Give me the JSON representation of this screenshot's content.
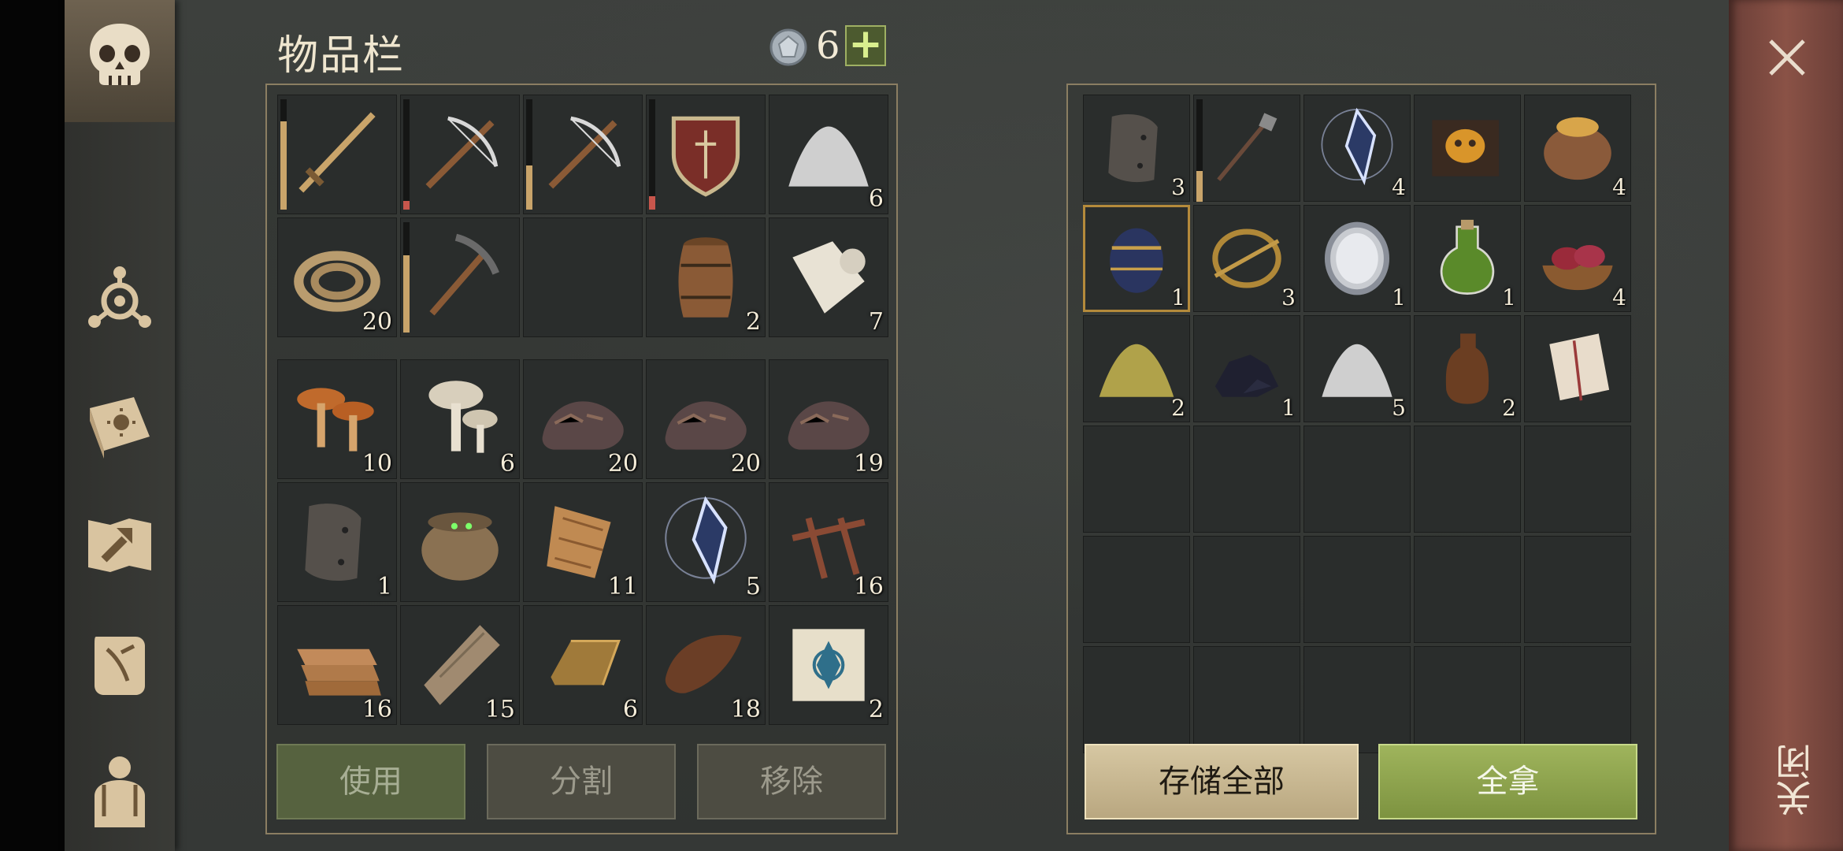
{
  "header": {
    "title": "物品栏",
    "currency_count": "6",
    "add_label": "+"
  },
  "sidebar": {
    "items": [
      {
        "icon": "skull-icon"
      },
      {
        "icon": "skills-tree-icon"
      },
      {
        "icon": "sun-journal-icon"
      },
      {
        "icon": "map-arrow-icon"
      },
      {
        "icon": "quest-scroll-icon"
      },
      {
        "icon": "character-equipment-icon"
      }
    ]
  },
  "equipment_grid": [
    {
      "item": "sword",
      "count": "",
      "durability": 0.8,
      "dur_color": "#c9a46a"
    },
    {
      "item": "crossbow",
      "count": "",
      "durability": 0.08,
      "dur_color": "#c8564c"
    },
    {
      "item": "crossbow",
      "count": "",
      "durability": 0.4,
      "dur_color": "#c9a46a"
    },
    {
      "item": "shield",
      "count": "",
      "durability": 0.12,
      "dur_color": "#c8564c"
    },
    {
      "item": "salt-pile",
      "count": "6"
    },
    {
      "item": "rope",
      "count": "20"
    },
    {
      "item": "pickaxe",
      "count": "",
      "durability": 0.7,
      "dur_color": "#c9a46a"
    },
    {
      "item": "empty",
      "count": ""
    },
    {
      "item": "barrel",
      "count": "2"
    },
    {
      "item": "cloth-roll",
      "count": "7"
    }
  ],
  "backpack_grid": [
    {
      "item": "mushrooms-orange",
      "count": "10"
    },
    {
      "item": "mushrooms-white",
      "count": "6"
    },
    {
      "item": "iron-ore",
      "count": "20"
    },
    {
      "item": "iron-ore",
      "count": "20"
    },
    {
      "item": "iron-ore",
      "count": "19"
    },
    {
      "item": "leather-pauldron",
      "count": "1"
    },
    {
      "item": "basket-with-eyes",
      "count": ""
    },
    {
      "item": "fiber-bundle",
      "count": "11"
    },
    {
      "item": "crystal",
      "count": "5"
    },
    {
      "item": "nails",
      "count": "16"
    },
    {
      "item": "leather-stack",
      "count": "16"
    },
    {
      "item": "plank",
      "count": "15"
    },
    {
      "item": "bronze-ingot",
      "count": "6"
    },
    {
      "item": "hide",
      "count": "18"
    },
    {
      "item": "pattern-scroll",
      "count": "2"
    }
  ],
  "storage_grid": [
    {
      "item": "leather-pauldron",
      "count": "3"
    },
    {
      "item": "mace",
      "count": "",
      "durability": 0.35,
      "dur_color": "#c9a46a"
    },
    {
      "item": "crystal",
      "count": "4"
    },
    {
      "item": "mask-book",
      "count": ""
    },
    {
      "item": "grain-sack",
      "count": "4"
    },
    {
      "item": "decorated-egg",
      "count": "1",
      "selected": true
    },
    {
      "item": "bronze-brooch",
      "count": "3"
    },
    {
      "item": "silver-mirror",
      "count": "1"
    },
    {
      "item": "green-potion",
      "count": "1"
    },
    {
      "item": "meat-bowl",
      "count": "4"
    },
    {
      "item": "sulfur-pile",
      "count": "2"
    },
    {
      "item": "coal",
      "count": "1"
    },
    {
      "item": "salt-pile",
      "count": "5"
    },
    {
      "item": "clay-bottle",
      "count": "2"
    },
    {
      "item": "paper-bundle",
      "count": ""
    },
    {
      "item": "empty"
    },
    {
      "item": "empty"
    },
    {
      "item": "empty"
    },
    {
      "item": "empty"
    },
    {
      "item": "empty"
    },
    {
      "item": "empty"
    },
    {
      "item": "empty"
    },
    {
      "item": "empty"
    },
    {
      "item": "empty"
    },
    {
      "item": "empty"
    },
    {
      "item": "empty"
    },
    {
      "item": "empty"
    },
    {
      "item": "empty"
    },
    {
      "item": "empty"
    },
    {
      "item": "empty"
    }
  ],
  "buttons": {
    "use": "使用",
    "split": "分割",
    "remove": "移除",
    "store_all": "存储全部",
    "take_all": "全拿"
  },
  "close": {
    "label": "关闭"
  }
}
